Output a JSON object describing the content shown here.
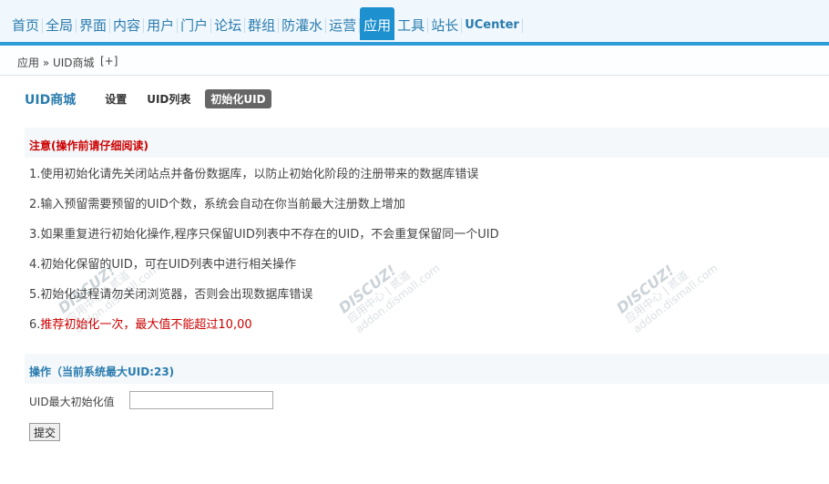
{
  "topnav": {
    "items": [
      "首页",
      "全局",
      "界面",
      "内容",
      "用户",
      "门户",
      "论坛",
      "群组",
      "防灌水",
      "运营",
      "应用",
      "工具",
      "站长",
      "UCenter"
    ],
    "active_index": 10
  },
  "breadcrumb": {
    "text": "应用 » UID商城",
    "add": "[+]"
  },
  "subnav": {
    "title": "UID商城",
    "tabs": [
      "设置",
      "UID列表",
      "初始化UID"
    ],
    "active_index": 2
  },
  "notice": {
    "title": "注意(操作前请仔细阅读)",
    "lines": [
      "1.使用初始化请先关闭站点并备份数据库，以防止初始化阶段的注册带来的数据库错误",
      "2.输入预留需要预留的UID个数，系统会自动在你当前最大注册数上增加",
      "3.如果重复进行初始化操作,程序只保留UID列表中不存在的UID，不会重复保留同一个UID",
      "4.初始化保留的UID，可在UID列表中进行相关操作",
      "5.初始化过程请勿关闭浏览器，否则会出现数据库错误"
    ],
    "warning_prefix": "6.",
    "warning": "推荐初始化一次，最大值不能超过10,00"
  },
  "operation": {
    "title": "操作（当前系统最大UID:23)",
    "field_label": "UID最大初始化值",
    "field_value": "",
    "submit_label": "提交"
  },
  "watermark": {
    "brand": "DISCUZ!",
    "line1": "应用中心 | 贰道",
    "line2": "addon.dismall.com"
  },
  "colors": {
    "accent": "#1d90cf",
    "link": "#2a7cae",
    "warning": "#cc0000"
  }
}
